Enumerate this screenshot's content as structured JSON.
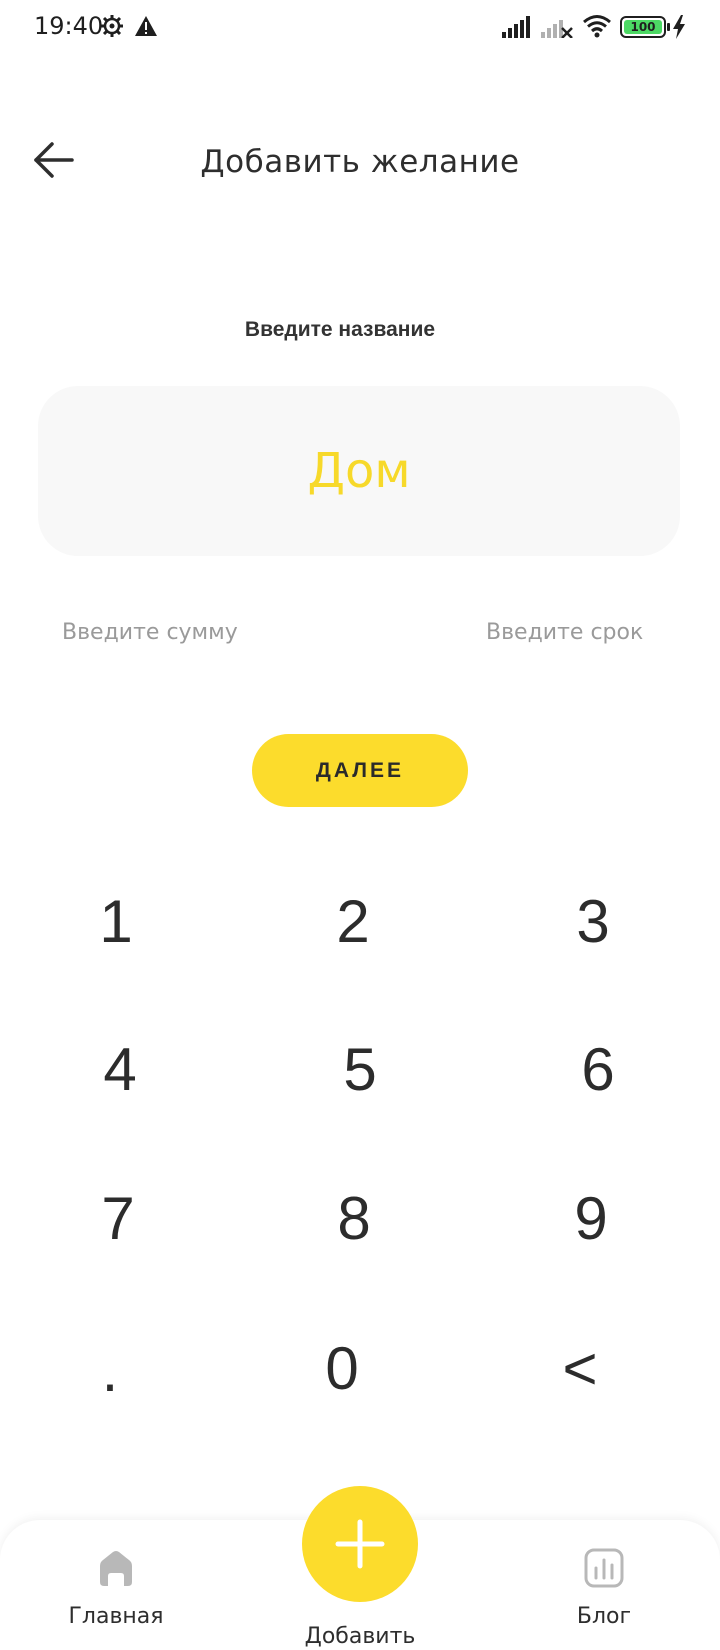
{
  "status_bar": {
    "time": "19:40",
    "battery": "100",
    "icons": [
      "gear-icon",
      "warning-icon",
      "signal-icon",
      "signal-no-sim-icon",
      "wifi-icon",
      "battery-icon",
      "charging-bolt-icon"
    ]
  },
  "header": {
    "back_icon": "arrow-left-icon",
    "title": "Добавить желание"
  },
  "form": {
    "name_label": "Введите название",
    "name_value": "Дом",
    "sum_link": "Введите сумму",
    "term_link": "Введите срок",
    "next_label": "ДАЛЕЕ"
  },
  "keypad": {
    "keys": [
      "1",
      "2",
      "3",
      "4",
      "5",
      "6",
      "7",
      "8",
      "9",
      ".",
      "0",
      "<"
    ]
  },
  "bottom_nav": {
    "home_label": "Главная",
    "add_label": "Добавить",
    "blog_label": "Блог",
    "icons": [
      "home-icon",
      "plus-icon",
      "chart-icon"
    ]
  },
  "colors": {
    "accent": "#fcdc2c",
    "input_text": "#f7d92a",
    "input_bg": "#f8f8f8",
    "muted_text": "#9a9a9a",
    "icon_grey": "#b8b8b8"
  }
}
